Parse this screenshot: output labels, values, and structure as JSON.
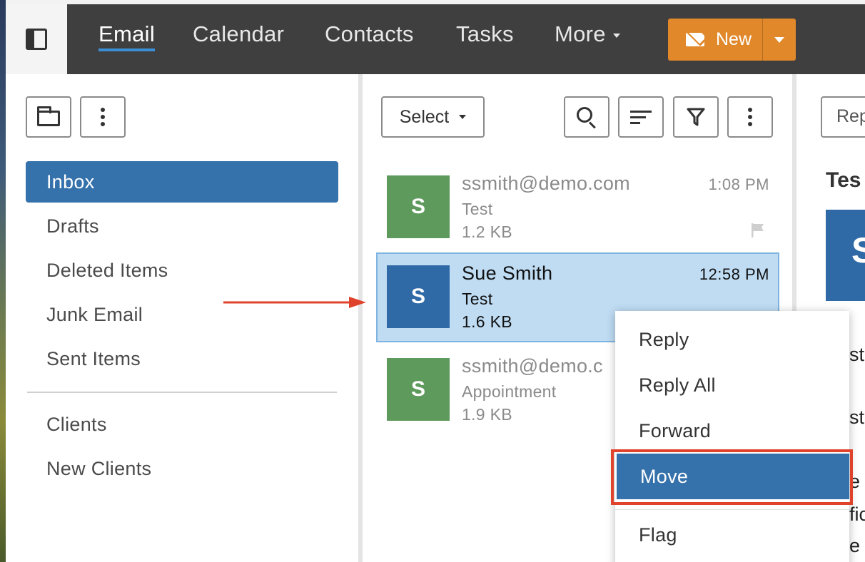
{
  "nav": {
    "tabs": [
      {
        "label": "Email"
      },
      {
        "label": "Calendar"
      },
      {
        "label": "Contacts"
      },
      {
        "label": "Tasks"
      },
      {
        "label": "More"
      }
    ],
    "new_label": "New"
  },
  "folders": {
    "items": [
      {
        "label": "Inbox",
        "active": true
      },
      {
        "label": "Drafts"
      },
      {
        "label": "Deleted Items"
      },
      {
        "label": "Junk Email"
      },
      {
        "label": "Sent Items"
      }
    ],
    "custom": [
      {
        "label": "Clients"
      },
      {
        "label": "New Clients"
      }
    ]
  },
  "list_toolbar": {
    "select_label": "Select"
  },
  "messages": [
    {
      "initial": "S",
      "from": "ssmith@demo.com",
      "subject": "Test",
      "size": "1.2 KB",
      "time": "1:08 PM",
      "avatar_color": "#5e9a5c",
      "flagged_icon": true
    },
    {
      "initial": "S",
      "from": "Sue Smith",
      "subject": "Test",
      "size": "1.6 KB",
      "time": "12:58 PM",
      "avatar_color": "#2f6aa6",
      "selected": true
    },
    {
      "initial": "S",
      "from": "ssmith@demo.c",
      "subject": "Appointment",
      "size": "1.9 KB",
      "time": "",
      "avatar_color": "#5e9a5c"
    }
  ],
  "reading_pane": {
    "reply_label": "Rep",
    "title": "Tes",
    "avatar_initial": "S",
    "fragments": [
      "st",
      "st",
      "e",
      "fic",
      "e"
    ]
  },
  "context_menu": {
    "items": [
      {
        "label": "Reply"
      },
      {
        "label": "Reply All"
      },
      {
        "label": "Forward"
      },
      {
        "label": "Move",
        "highlighted": true
      },
      {
        "label": "Flag"
      }
    ]
  },
  "colors": {
    "nav_bg": "#3f3f3f",
    "accent_blue": "#3571ab",
    "new_button": "#e1882a",
    "selected_row": "#bfdcf3",
    "annotation_red": "#e0432b"
  }
}
